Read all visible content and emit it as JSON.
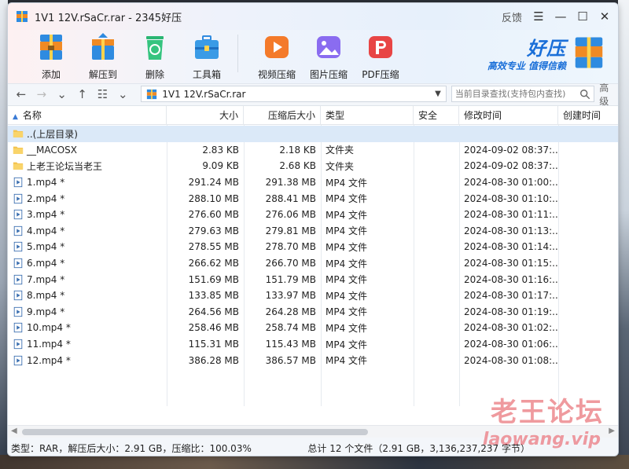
{
  "window": {
    "title": "1V1 12V.rSaCr.rar - 2345好压",
    "feedback": "反馈",
    "menu_glyph": "☰",
    "min_glyph": "—",
    "max_glyph": "☐",
    "close_glyph": "✕"
  },
  "toolbar": {
    "add": "添加",
    "extract_to": "解压到",
    "delete": "删除",
    "toolbox": "工具箱",
    "video_compress": "视频压缩",
    "image_compress": "图片压缩",
    "pdf_compress": "PDF压缩"
  },
  "brand": {
    "name": "好压",
    "slogan": "高效专业 值得信赖"
  },
  "nav": {
    "path": "1V1 12V.rSaCr.rar",
    "search_placeholder": "当前目录查找(支持包内查找)",
    "advanced": "高级"
  },
  "columns": {
    "name": "名称",
    "size": "大小",
    "compressed": "压缩后大小",
    "type": "类型",
    "security": "安全",
    "modified": "修改时间",
    "created": "创建时间"
  },
  "files": [
    {
      "name": "..(上层目录)",
      "size": "",
      "compressed": "",
      "type": "",
      "modified": "",
      "kind": "folder"
    },
    {
      "name": "__MACOSX",
      "size": "2.83 KB",
      "compressed": "2.18 KB",
      "type": "文件夹",
      "modified": "2024-09-02 08:37:...",
      "kind": "folder"
    },
    {
      "name": "上老王论坛当老王",
      "size": "9.09 KB",
      "compressed": "2.68 KB",
      "type": "文件夹",
      "modified": "2024-09-02 08:37:...",
      "kind": "folder"
    },
    {
      "name": "1.mp4 *",
      "size": "291.24 MB",
      "compressed": "291.38 MB",
      "type": "MP4 文件",
      "modified": "2024-08-30 01:00:...",
      "kind": "file"
    },
    {
      "name": "2.mp4 *",
      "size": "288.10 MB",
      "compressed": "288.41 MB",
      "type": "MP4 文件",
      "modified": "2024-08-30 01:10:...",
      "kind": "file"
    },
    {
      "name": "3.mp4 *",
      "size": "276.60 MB",
      "compressed": "276.06 MB",
      "type": "MP4 文件",
      "modified": "2024-08-30 01:11:...",
      "kind": "file"
    },
    {
      "name": "4.mp4 *",
      "size": "279.63 MB",
      "compressed": "279.81 MB",
      "type": "MP4 文件",
      "modified": "2024-08-30 01:13:...",
      "kind": "file"
    },
    {
      "name": "5.mp4 *",
      "size": "278.55 MB",
      "compressed": "278.70 MB",
      "type": "MP4 文件",
      "modified": "2024-08-30 01:14:...",
      "kind": "file"
    },
    {
      "name": "6.mp4 *",
      "size": "266.62 MB",
      "compressed": "266.70 MB",
      "type": "MP4 文件",
      "modified": "2024-08-30 01:15:...",
      "kind": "file"
    },
    {
      "name": "7.mp4 *",
      "size": "151.69 MB",
      "compressed": "151.79 MB",
      "type": "MP4 文件",
      "modified": "2024-08-30 01:16:...",
      "kind": "file"
    },
    {
      "name": "8.mp4 *",
      "size": "133.85 MB",
      "compressed": "133.97 MB",
      "type": "MP4 文件",
      "modified": "2024-08-30 01:17:...",
      "kind": "file"
    },
    {
      "name": "9.mp4 *",
      "size": "264.56 MB",
      "compressed": "264.28 MB",
      "type": "MP4 文件",
      "modified": "2024-08-30 01:19:...",
      "kind": "file"
    },
    {
      "name": "10.mp4 *",
      "size": "258.46 MB",
      "compressed": "258.74 MB",
      "type": "MP4 文件",
      "modified": "2024-08-30 01:02:...",
      "kind": "file"
    },
    {
      "name": "11.mp4 *",
      "size": "115.31 MB",
      "compressed": "115.43 MB",
      "type": "MP4 文件",
      "modified": "2024-08-30 01:06:...",
      "kind": "file"
    },
    {
      "name": "12.mp4 *",
      "size": "386.28 MB",
      "compressed": "386.57 MB",
      "type": "MP4 文件",
      "modified": "2024-08-30 01:08:...",
      "kind": "file"
    }
  ],
  "status": {
    "left": "类型：RAR，解压后大小：2.91 GB，压缩比：100.03%",
    "right": "总计 12 个文件（2.91 GB，3,136,237,237 字节）"
  },
  "watermark": {
    "line1": "老王论坛",
    "line2": "laowang.vip"
  },
  "colors": {
    "accent": "#1a6fd8",
    "selection": "#dbe9f8",
    "watermark": "#dc1e28"
  }
}
